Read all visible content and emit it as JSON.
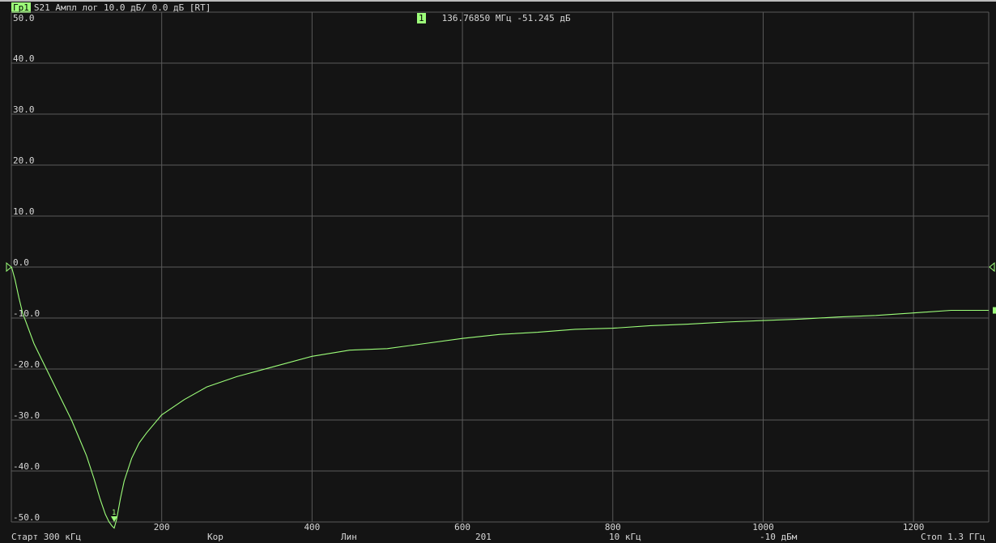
{
  "header": {
    "trace_tag": "Гр1",
    "trace_desc": "S21 Ампл лог 10.0 дБ/ 0.0 дБ [RT]"
  },
  "marker_info": {
    "number": "1",
    "text": "136.76850 МГц -51.245 дБ"
  },
  "footer": {
    "start": "Старт 300 кГц",
    "format": "Кор",
    "sweep_type": "Лин",
    "points": "201",
    "ifbw": "10 кГц",
    "power": "-10 дБм",
    "stop": "Стоп 1.3 ГГц"
  },
  "colors": {
    "background": "#141414",
    "grid": "#5a5a5a",
    "trace": "#9dff7a",
    "text": "#d8d8d8"
  },
  "chart_data": {
    "type": "line",
    "title": "S21 Ампл лог 10.0 дБ/ 0.0 дБ [RT]",
    "xlabel": "",
    "ylabel": "",
    "xlim": [
      0,
      1300
    ],
    "ylim": [
      -50,
      50
    ],
    "x_ticks": [
      "200",
      "400",
      "600",
      "800",
      "1000",
      "1200"
    ],
    "y_ticks": [
      "50.0",
      "40.0",
      "30.0",
      "20.0",
      "10.0",
      "0.0",
      "-10.0",
      "-20.0",
      "-30.0",
      "-40.0",
      "-50.0"
    ],
    "grid": true,
    "reference_level": 0,
    "series": [
      {
        "values_x": [
          0.3,
          5,
          10,
          15,
          20,
          30,
          40,
          50,
          60,
          70,
          80,
          90,
          100,
          110,
          118,
          125,
          130,
          134,
          136.8,
          140,
          145,
          150,
          160,
          170,
          180,
          200,
          230,
          260,
          300,
          350,
          400,
          450,
          500,
          550,
          600,
          650,
          700,
          750,
          800,
          850,
          900,
          950,
          1000,
          1050,
          1100,
          1150,
          1200,
          1250,
          1300
        ],
        "values_y": [
          0,
          -2.5,
          -6,
          -9,
          -11,
          -15,
          -18,
          -21,
          -24,
          -27,
          -30,
          -33.5,
          -37,
          -41.5,
          -45.5,
          -48.5,
          -50,
          -50.8,
          -51.2,
          -49.5,
          -45.5,
          -42,
          -37.5,
          -34.5,
          -32.5,
          -29,
          -26,
          -23.5,
          -21.5,
          -19.5,
          -17.5,
          -16.3,
          -16,
          -15,
          -14,
          -13.2,
          -12.8,
          -12.2,
          -12,
          -11.5,
          -11.2,
          -10.8,
          -10.5,
          -10.2,
          -9.8,
          -9.5,
          -9,
          -8.5,
          -8.5
        ]
      }
    ],
    "markers": [
      {
        "number": "1",
        "x": 136.7685,
        "y": -51.245
      }
    ]
  }
}
